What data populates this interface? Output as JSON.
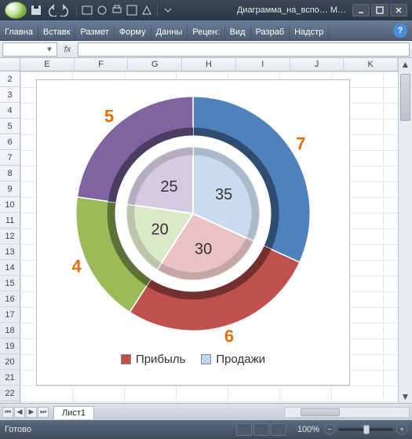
{
  "window": {
    "title": "Диаграмма_на_вспо… M…"
  },
  "ribbon": {
    "tabs": [
      "Главна",
      "Вставк",
      "Размет",
      "Форму",
      "Данны",
      "Рецен:",
      "Вид",
      "Разраб",
      "Надстр"
    ]
  },
  "formula": {
    "namebox": "",
    "fx_label": "fx",
    "value": ""
  },
  "grid": {
    "columns": [
      "E",
      "F",
      "G",
      "H",
      "I",
      "J",
      "K"
    ],
    "rows": [
      "2",
      "3",
      "4",
      "5",
      "6",
      "7",
      "8",
      "9",
      "10",
      "11",
      "12",
      "13",
      "14",
      "15",
      "16",
      "17",
      "18",
      "19",
      "20",
      "21",
      "22"
    ]
  },
  "sheet_tabs": {
    "active": "Лист1"
  },
  "status": {
    "ready": "Готово",
    "zoom": "100%"
  },
  "legend": {
    "item1": "Прибыль",
    "item2": "Продажи"
  },
  "chart_data": {
    "type": "pie",
    "title": "",
    "series": [
      {
        "name": "Прибыль",
        "ring": "outer",
        "labels": [
          "7",
          "6",
          "4",
          "5"
        ],
        "values": [
          7,
          6,
          4,
          5
        ],
        "colors": [
          "#4f81bd",
          "#c0504d",
          "#9bbb59",
          "#8064a2"
        ],
        "label_color": "#e46c0a"
      },
      {
        "name": "Продажи",
        "ring": "inner",
        "labels": [
          "35",
          "30",
          "20",
          "25"
        ],
        "values": [
          35,
          30,
          20,
          25
        ],
        "colors": [
          "#c8dbef",
          "#e9c3c4",
          "#dbe9c9",
          "#d4cbe2"
        ],
        "label_color": "#333333"
      }
    ]
  }
}
